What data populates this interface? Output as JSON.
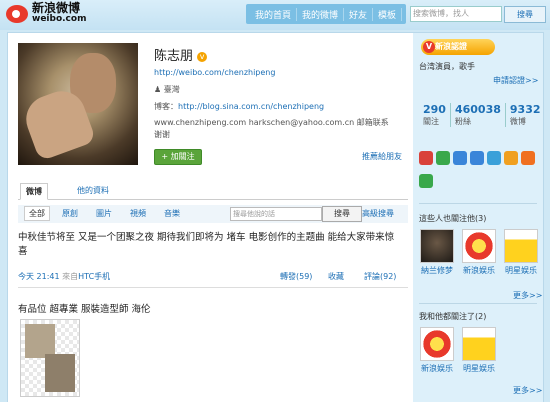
{
  "header": {
    "logo_cn": "新浪微博",
    "logo_en": "weibo.com",
    "nav": [
      "我的首頁",
      "我的微博",
      "好友",
      "模板"
    ],
    "search_placeholder": "搜索微博，找人",
    "search_button": "搜尋"
  },
  "profile": {
    "name": "陈志朋",
    "verified_mark": "v",
    "url": "http://weibo.com/chenzhipeng",
    "gender_icon": "male-user-icon",
    "location": "臺灣",
    "blog_label": "博客：",
    "blog_url": "http://blog.sina.com.cn/chenzhipeng",
    "contact": "www.chenzhipeng.com harkschen@yahoo.com.cn 邮箱联系 谢谢",
    "follow_button": "+ 加關注",
    "recommend": "推薦給朋友"
  },
  "tabs": {
    "weibo": "微博",
    "info": "他的資料"
  },
  "filter": {
    "items": [
      "全部",
      "原創",
      "圖片",
      "視頻",
      "音樂"
    ],
    "search_placeholder": "搜尋他說的話",
    "search_button": "搜尋",
    "advanced": "高級搜尋"
  },
  "posts": [
    {
      "text": "中秋佳节将至 又是一个团聚之夜 期待我们即将为 堵车 电影创作的主题曲 能给大家带来惊喜",
      "time": "今天 21:41",
      "source_prefix": "來自",
      "source": "HTC手机",
      "forward": "轉發(59)",
      "favorite": "收藏",
      "comment": "評論(92)"
    },
    {
      "text": "有品位 超專業 服裝造型師 海伦"
    }
  ],
  "sidebar": {
    "verify_badge": "新浪認證",
    "desc": "台湾演員，歌手",
    "apply_verify": "申請認證>>",
    "stats": [
      {
        "value": "290",
        "label": "關注"
      },
      {
        "value": "460038",
        "label": "粉絲"
      },
      {
        "value": "9332",
        "label": "微博"
      }
    ],
    "icon_colors": [
      "#d9423a",
      "#39a84b",
      "#3a85d9",
      "#3a85d9",
      "#3aa0d9",
      "#f0a020",
      "#f07020",
      "#39a84b"
    ],
    "also_follow_title": "這些人也關注他(3)",
    "also_follow": [
      {
        "name": "納兰修梦",
        "pic": "dark"
      },
      {
        "name": "新浪娱乐",
        "pic": "sina"
      },
      {
        "name": "明星娱乐",
        "pic": "star"
      }
    ],
    "more1": "更多>>",
    "mutual_title": "我和他都關注了(2)",
    "mutual": [
      {
        "name": "新浪娱乐",
        "pic": "sina"
      },
      {
        "name": "明星娱乐",
        "pic": "star"
      }
    ],
    "more2": "更多>>"
  }
}
